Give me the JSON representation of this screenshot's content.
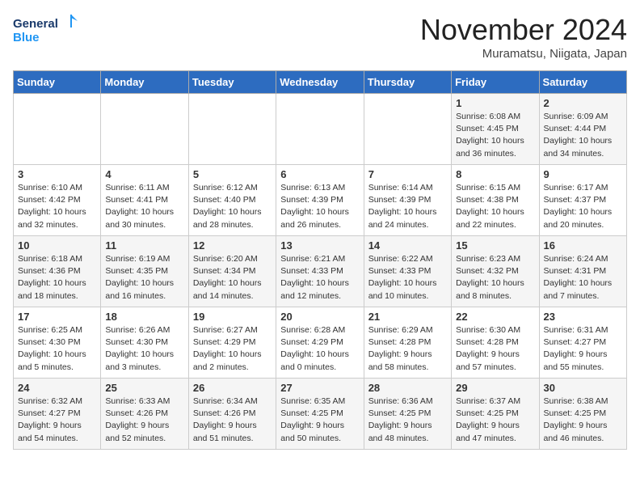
{
  "logo": {
    "line1": "General",
    "line2": "Blue"
  },
  "title": "November 2024",
  "location": "Muramatsu, Niigata, Japan",
  "days_of_week": [
    "Sunday",
    "Monday",
    "Tuesday",
    "Wednesday",
    "Thursday",
    "Friday",
    "Saturday"
  ],
  "weeks": [
    [
      {
        "day": "",
        "info": ""
      },
      {
        "day": "",
        "info": ""
      },
      {
        "day": "",
        "info": ""
      },
      {
        "day": "",
        "info": ""
      },
      {
        "day": "",
        "info": ""
      },
      {
        "day": "1",
        "info": "Sunrise: 6:08 AM\nSunset: 4:45 PM\nDaylight: 10 hours\nand 36 minutes."
      },
      {
        "day": "2",
        "info": "Sunrise: 6:09 AM\nSunset: 4:44 PM\nDaylight: 10 hours\nand 34 minutes."
      }
    ],
    [
      {
        "day": "3",
        "info": "Sunrise: 6:10 AM\nSunset: 4:42 PM\nDaylight: 10 hours\nand 32 minutes."
      },
      {
        "day": "4",
        "info": "Sunrise: 6:11 AM\nSunset: 4:41 PM\nDaylight: 10 hours\nand 30 minutes."
      },
      {
        "day": "5",
        "info": "Sunrise: 6:12 AM\nSunset: 4:40 PM\nDaylight: 10 hours\nand 28 minutes."
      },
      {
        "day": "6",
        "info": "Sunrise: 6:13 AM\nSunset: 4:39 PM\nDaylight: 10 hours\nand 26 minutes."
      },
      {
        "day": "7",
        "info": "Sunrise: 6:14 AM\nSunset: 4:39 PM\nDaylight: 10 hours\nand 24 minutes."
      },
      {
        "day": "8",
        "info": "Sunrise: 6:15 AM\nSunset: 4:38 PM\nDaylight: 10 hours\nand 22 minutes."
      },
      {
        "day": "9",
        "info": "Sunrise: 6:17 AM\nSunset: 4:37 PM\nDaylight: 10 hours\nand 20 minutes."
      }
    ],
    [
      {
        "day": "10",
        "info": "Sunrise: 6:18 AM\nSunset: 4:36 PM\nDaylight: 10 hours\nand 18 minutes."
      },
      {
        "day": "11",
        "info": "Sunrise: 6:19 AM\nSunset: 4:35 PM\nDaylight: 10 hours\nand 16 minutes."
      },
      {
        "day": "12",
        "info": "Sunrise: 6:20 AM\nSunset: 4:34 PM\nDaylight: 10 hours\nand 14 minutes."
      },
      {
        "day": "13",
        "info": "Sunrise: 6:21 AM\nSunset: 4:33 PM\nDaylight: 10 hours\nand 12 minutes."
      },
      {
        "day": "14",
        "info": "Sunrise: 6:22 AM\nSunset: 4:33 PM\nDaylight: 10 hours\nand 10 minutes."
      },
      {
        "day": "15",
        "info": "Sunrise: 6:23 AM\nSunset: 4:32 PM\nDaylight: 10 hours\nand 8 minutes."
      },
      {
        "day": "16",
        "info": "Sunrise: 6:24 AM\nSunset: 4:31 PM\nDaylight: 10 hours\nand 7 minutes."
      }
    ],
    [
      {
        "day": "17",
        "info": "Sunrise: 6:25 AM\nSunset: 4:30 PM\nDaylight: 10 hours\nand 5 minutes."
      },
      {
        "day": "18",
        "info": "Sunrise: 6:26 AM\nSunset: 4:30 PM\nDaylight: 10 hours\nand 3 minutes."
      },
      {
        "day": "19",
        "info": "Sunrise: 6:27 AM\nSunset: 4:29 PM\nDaylight: 10 hours\nand 2 minutes."
      },
      {
        "day": "20",
        "info": "Sunrise: 6:28 AM\nSunset: 4:29 PM\nDaylight: 10 hours\nand 0 minutes."
      },
      {
        "day": "21",
        "info": "Sunrise: 6:29 AM\nSunset: 4:28 PM\nDaylight: 9 hours\nand 58 minutes."
      },
      {
        "day": "22",
        "info": "Sunrise: 6:30 AM\nSunset: 4:28 PM\nDaylight: 9 hours\nand 57 minutes."
      },
      {
        "day": "23",
        "info": "Sunrise: 6:31 AM\nSunset: 4:27 PM\nDaylight: 9 hours\nand 55 minutes."
      }
    ],
    [
      {
        "day": "24",
        "info": "Sunrise: 6:32 AM\nSunset: 4:27 PM\nDaylight: 9 hours\nand 54 minutes."
      },
      {
        "day": "25",
        "info": "Sunrise: 6:33 AM\nSunset: 4:26 PM\nDaylight: 9 hours\nand 52 minutes."
      },
      {
        "day": "26",
        "info": "Sunrise: 6:34 AM\nSunset: 4:26 PM\nDaylight: 9 hours\nand 51 minutes."
      },
      {
        "day": "27",
        "info": "Sunrise: 6:35 AM\nSunset: 4:25 PM\nDaylight: 9 hours\nand 50 minutes."
      },
      {
        "day": "28",
        "info": "Sunrise: 6:36 AM\nSunset: 4:25 PM\nDaylight: 9 hours\nand 48 minutes."
      },
      {
        "day": "29",
        "info": "Sunrise: 6:37 AM\nSunset: 4:25 PM\nDaylight: 9 hours\nand 47 minutes."
      },
      {
        "day": "30",
        "info": "Sunrise: 6:38 AM\nSunset: 4:25 PM\nDaylight: 9 hours\nand 46 minutes."
      }
    ]
  ]
}
